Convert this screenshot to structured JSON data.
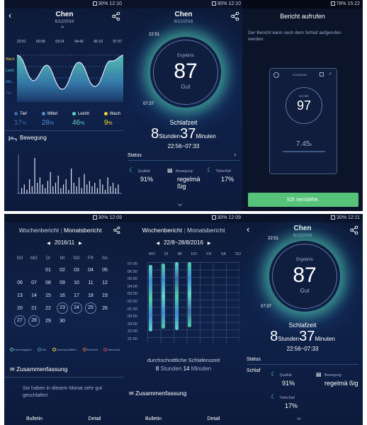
{
  "colors": {
    "deep": "#3d6ba8",
    "mid": "#4e8fd0",
    "light": "#5fd6c8",
    "awake": "#f2d33a",
    "accent": "#4fd0a4",
    "green_btn": "#56c27a"
  },
  "p1": {
    "status_time": "12:10",
    "status_batt": "30%",
    "title": "Chen",
    "date": "6/12/2016",
    "times": [
      "22:51",
      "00:39",
      "03:14",
      "04:42",
      "06:10",
      "07:37"
    ],
    "levels": [
      "Wach",
      "Leich",
      "Mitt...",
      "Tief"
    ],
    "stages": [
      {
        "name": "Tief",
        "pct": "17",
        "unit": "%",
        "color": "#3d6ba8"
      },
      {
        "name": "Mittel",
        "pct": "28",
        "unit": "%",
        "color": "#4e8fd0"
      },
      {
        "name": "Leicht",
        "pct": "46",
        "unit": "%",
        "color": "#5fd6c8"
      },
      {
        "name": "Wach",
        "pct": "9",
        "unit": "%",
        "color": "#f2d33a"
      }
    ],
    "movement_title": "Bewegung",
    "movement_bars": [
      3,
      5,
      2,
      8,
      4,
      20,
      6,
      9,
      5,
      3,
      7,
      12,
      4,
      6,
      10,
      3,
      5,
      8,
      2,
      14,
      6,
      4,
      9,
      3,
      11,
      5,
      7,
      4,
      6,
      3,
      8,
      5,
      2,
      9,
      4,
      6,
      3,
      5
    ]
  },
  "p2": {
    "status_time": "12:10",
    "status_batt": "30%",
    "title": "Chen",
    "date": "6/12/2016",
    "start": "22:51",
    "end": "07:37",
    "result_label": "Ergebnis",
    "score": "87",
    "grade": "Gut",
    "sleep_label": "Schlafzeit",
    "hours": "8",
    "hours_unit": "Stunden",
    "minutes": "37",
    "minutes_unit": "Minuten",
    "range": "22:56~07:33",
    "status_label": "Status",
    "stats": [
      {
        "label": "Qualität",
        "value": "91%"
      },
      {
        "label": "Bewegung",
        "value": "regelmä ßig"
      },
      {
        "label": "Tiefschlaf",
        "value": "17%"
      }
    ]
  },
  "p3": {
    "status_time": "15:22",
    "status_batt": "78%",
    "title": "Bericht aufrufen",
    "text": "Der Bericht kann nach dem Schlaf aufgerufen werden.",
    "date": "2016/06/29",
    "score_label": "SCORE",
    "score": "97",
    "time": "7.45",
    "time_unit": "h",
    "button": "Ich verstehe."
  },
  "p4": {
    "status_time": "12:09",
    "status_batt": "30%",
    "tab_week": "Wochenbericht",
    "tab_month": "Monatsbericht",
    "month": "2016/11",
    "days": [
      "SO",
      "MO",
      "DI",
      "MI",
      "DO",
      "FR",
      "SA"
    ],
    "weeks": [
      [
        "",
        "",
        "01",
        "02",
        "03",
        "04",
        "05"
      ],
      [
        "06",
        "07",
        "08",
        "09",
        "10",
        "11",
        "12"
      ],
      [
        "13",
        "14",
        "15",
        "16",
        "17",
        "18",
        "19"
      ],
      [
        "20",
        "21",
        "22",
        "23",
        "24",
        "25",
        "26"
      ],
      [
        "27",
        "28",
        "29",
        "30",
        "",
        "",
        ""
      ]
    ],
    "circled": [
      "23",
      "24",
      "25",
      "27",
      "28"
    ],
    "legend": [
      "Hervorragend",
      "Gut",
      "Durchschnittlich",
      "Schlecht",
      "Abnormal"
    ],
    "summary_title": "Zusammenfassung",
    "summary": "Sie haben in diesem Monat sehr gut geschlafen!",
    "bottom": [
      "Bulletin",
      "Detail"
    ]
  },
  "p5": {
    "status_time": "12:09",
    "status_batt": "30%",
    "tab_week": "Wochenbericht",
    "tab_month": "Monatsbericht",
    "range": "22/8~28/8/2016",
    "days": [
      "MO",
      "DI",
      "MI",
      "DO",
      "FR",
      "SA",
      "SO"
    ],
    "hours": [
      "07:00",
      "06:00",
      "05:00",
      "04:00",
      "03:00",
      "02:00",
      "01:00",
      "00:00",
      "23:00",
      "22:00",
      "21:00"
    ],
    "avg_label": "durchschnittliche Schlafenszeit",
    "avg_h": "8",
    "avg_h_unit": "Stunden",
    "avg_m": "14",
    "avg_m_unit": "Minuten",
    "summary_title": "Zusammenfassung",
    "bottom": [
      "Bulletin",
      "Detail"
    ]
  },
  "p6": {
    "status_time": "12:11",
    "status_batt": "30%",
    "title": "Chen",
    "date": "6/12/2016",
    "start": "22:51",
    "end": "07:37",
    "result_label": "Ergebnis",
    "score": "87",
    "grade": "Gut",
    "sleep_label": "Schlafzeit",
    "hours": "8",
    "hours_unit": "Stunden",
    "minutes": "37",
    "minutes_unit": "Minuten",
    "range": "22:56~07:33",
    "status_label": "Status",
    "sleep_label2": "Schlaf",
    "stats": [
      {
        "label": "Qualität",
        "value": "91%"
      },
      {
        "label": "Bewegung",
        "value": "regelmä ßig"
      },
      {
        "label": "Tiefschlaf",
        "value": "17%"
      }
    ]
  }
}
